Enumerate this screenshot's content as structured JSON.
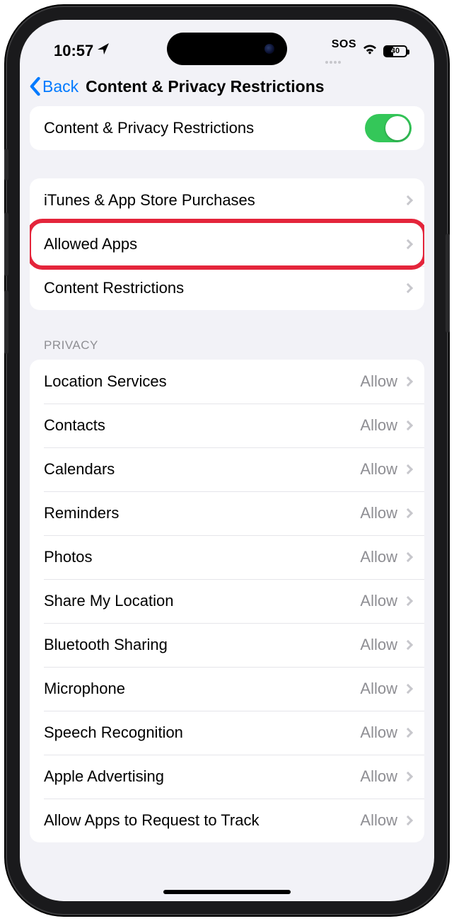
{
  "status": {
    "time": "10:57",
    "sos": "SOS",
    "battery_pct": "40"
  },
  "nav": {
    "back_label": "Back",
    "title": "Content & Privacy Restrictions"
  },
  "master_toggle": {
    "label": "Content & Privacy Restrictions",
    "on": true
  },
  "general_rows": [
    {
      "label": "iTunes & App Store Purchases"
    },
    {
      "label": "Allowed Apps",
      "highlighted": true
    },
    {
      "label": "Content Restrictions"
    }
  ],
  "privacy": {
    "header": "Privacy",
    "rows": [
      {
        "label": "Location Services",
        "value": "Allow"
      },
      {
        "label": "Contacts",
        "value": "Allow"
      },
      {
        "label": "Calendars",
        "value": "Allow"
      },
      {
        "label": "Reminders",
        "value": "Allow"
      },
      {
        "label": "Photos",
        "value": "Allow"
      },
      {
        "label": "Share My Location",
        "value": "Allow"
      },
      {
        "label": "Bluetooth Sharing",
        "value": "Allow"
      },
      {
        "label": "Microphone",
        "value": "Allow"
      },
      {
        "label": "Speech Recognition",
        "value": "Allow"
      },
      {
        "label": "Apple Advertising",
        "value": "Allow"
      },
      {
        "label": "Allow Apps to Request to Track",
        "value": "Allow"
      }
    ]
  }
}
